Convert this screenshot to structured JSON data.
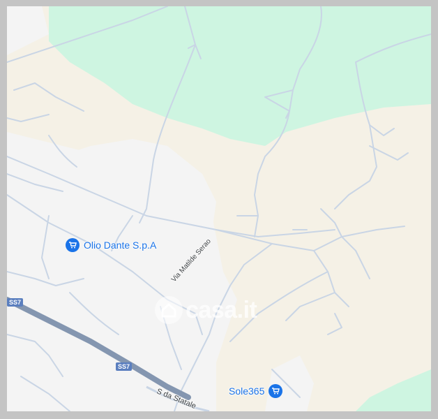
{
  "map": {
    "colors": {
      "park": "#cef5e1",
      "terrain": "#f5f1e6",
      "urban": "#f4f4f4",
      "road": "#c9d5e5",
      "highway": "#8496b0",
      "poi": "#1a73e8"
    },
    "pois": [
      {
        "label": "Olio Dante S.p.A",
        "icon": "shopping-cart-icon"
      },
      {
        "label": "Sole365",
        "icon": "shopping-cart-icon"
      }
    ],
    "roads": {
      "via_matilde_serao": "Via Matilde Serao",
      "statale": "S da Statale"
    },
    "shields": [
      "SS7",
      "SS7"
    ],
    "watermark": "casa.it"
  }
}
